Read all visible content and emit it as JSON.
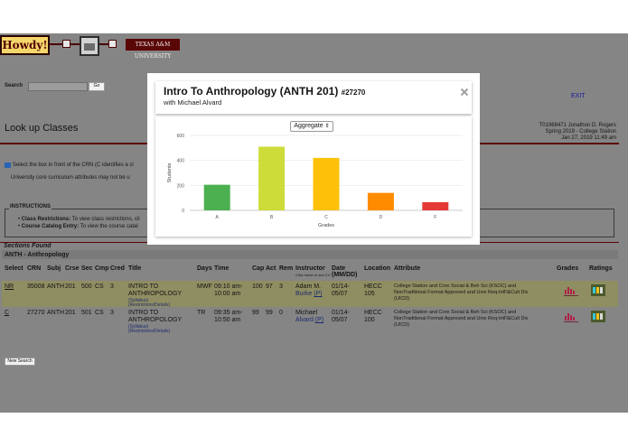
{
  "header": {
    "logo_text": "Howdy!",
    "tamu_logo_text": "TEXAS A&M UNIVERSITY",
    "exit_label": "EXIT"
  },
  "search": {
    "label": "Search",
    "value": "",
    "go_label": "Go"
  },
  "page_title": "Look up Classes",
  "user_info": {
    "line1": "T01968471 Jonathon D. Rogers",
    "line2": "Spring 2019 - College Station",
    "line3": "Jan 27, 2019 11:49 am"
  },
  "notes": {
    "line1": "Select the box in front of the CRN (C identifies a cl",
    "line2": "University core curriculum attributes may not be u"
  },
  "instructions": {
    "title": "INSTRUCTIONS",
    "item1_label": "Class Restrictions:",
    "item1_text": " To view class restrictions, cli",
    "item2_label": "Course Catalog Entry:",
    "item2_text": " To view the course catal"
  },
  "sections": {
    "heading": "Sections Found",
    "subheading": "ANTH - Anthropology",
    "columns": [
      "Select",
      "CRN",
      "Subj",
      "Crse",
      "Sec",
      "Cmp",
      "Cred",
      "Title",
      "Days",
      "Time",
      "Cap",
      "Act",
      "Rem",
      "Instructor",
      "Date (MM/DD)",
      "Location",
      "Attribute",
      "Grades",
      "Ratings"
    ],
    "instructor_hint": "Click name to see CV",
    "rows": [
      {
        "select": "NR",
        "crn": "35008",
        "subj": "ANTH",
        "crse": "201",
        "sec": "500",
        "cmp": "CS",
        "cred": "3",
        "title1": "INTRO TO",
        "title2": "ANTHROPOLOGY",
        "syllabus": "(Syllabus)",
        "restrictions": "(Restrictions/Details)",
        "days": "MWF",
        "time1": "09:10 am-",
        "time2": "10:00 am",
        "cap": "100",
        "act": "97",
        "rem": "3",
        "instructor1": "Adam M.",
        "instructor2": "Burke",
        "instructor_p": "(P)",
        "date1": "01/14-",
        "date2": "05/07",
        "loc1": "HECC",
        "loc2": "105",
        "attr1": "College Station and Core Social & Beh Sci (KSOC) and",
        "attr2": "NonTraditional Format Approved and Univ Req-Intl'l&Cult Div",
        "attr3": "(UICD)"
      },
      {
        "select": "C",
        "crn": "27270",
        "subj": "ANTH",
        "crse": "201",
        "sec": "501",
        "cmp": "CS",
        "cred": "3",
        "title1": "INTRO TO",
        "title2": "ANTHROPOLOGY",
        "syllabus": "(Syllabus)",
        "restrictions": "(Restrictions/Details)",
        "days": "TR",
        "time1": "09:35 am-",
        "time2": "10:50 am",
        "cap": "99",
        "act": "99",
        "rem": "0",
        "instructor1": "Michael",
        "instructor2": "Alvard",
        "instructor_p": "(P)",
        "date1": "01/14-",
        "date2": "05/07",
        "loc1": "HECC",
        "loc2": "100",
        "attr1": "College Station and Core Social & Beh Sci (KSOC) and",
        "attr2": "NonTraditional Format Approved and Univ Req-Intl'l&Cult Div",
        "attr3": "(UICD)"
      }
    ]
  },
  "new_search_label": "New Search",
  "modal": {
    "title": "Intro To Anthropology (ANTH 201)",
    "crn": "#27270",
    "subtitle": "with Michael Alvard",
    "close_icon": "close-icon",
    "dropdown_value": "Aggregate",
    "dropdown_arrows": "⇕"
  },
  "chart_data": {
    "type": "bar",
    "categories": [
      "A",
      "B",
      "C",
      "D",
      "F"
    ],
    "values": [
      205,
      510,
      420,
      140,
      65
    ],
    "colors": [
      "#4cb050",
      "#cddc39",
      "#ffc107",
      "#ff8c00",
      "#e53935"
    ],
    "xlabel": "Grades",
    "ylabel": "Students",
    "ylim": [
      0,
      600
    ],
    "yticks": [
      "0",
      "200",
      "400",
      "600"
    ],
    "grid": true
  }
}
